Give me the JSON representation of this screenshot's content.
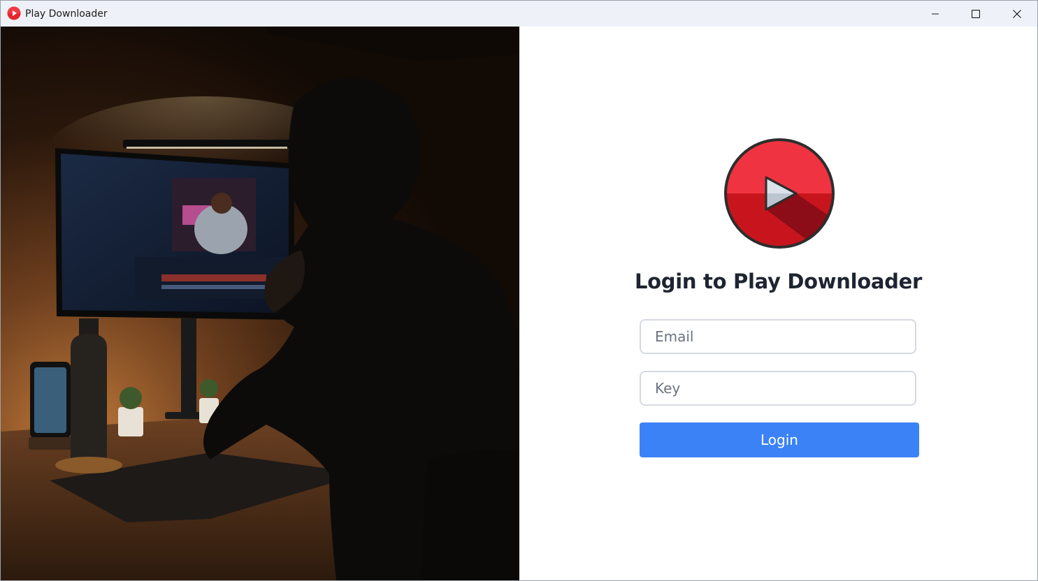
{
  "window": {
    "title": "Play Downloader"
  },
  "colors": {
    "accent": "#3b82f6",
    "logo_red": "#ef3340",
    "logo_dark_red": "#c8151d"
  },
  "hero_image": {
    "icon": "photo-of-person-editing-video"
  },
  "login": {
    "heading": "Login to Play Downloader",
    "email_placeholder": "Email",
    "key_placeholder": "Key",
    "button_label": "Login"
  }
}
